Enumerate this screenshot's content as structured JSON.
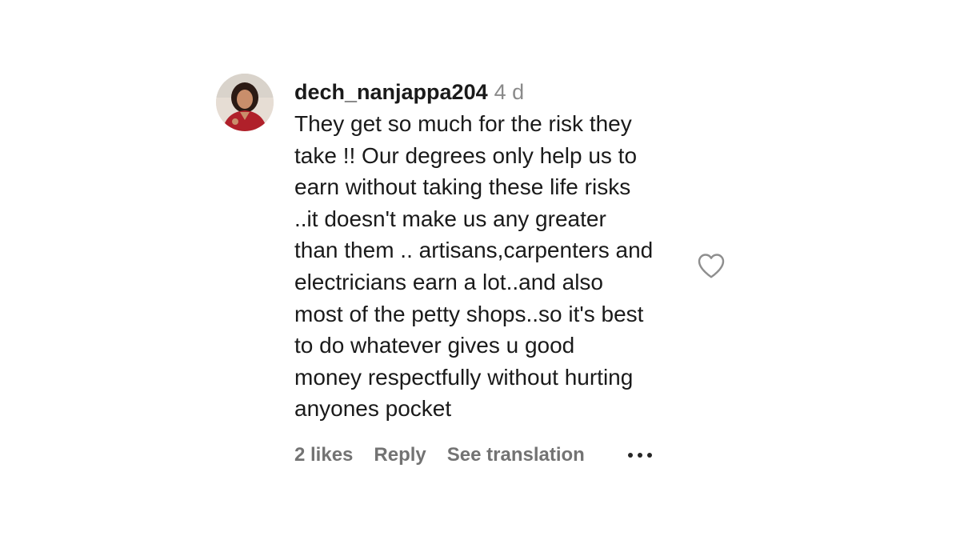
{
  "comment": {
    "username": "dech_nanjappa204",
    "time": "4 d",
    "text": "They get so much for the risk they\ntake !! Our degrees only help us to\nearn without taking these life risks\n..it doesn't make us any greater\nthan them .. artisans,carpenters and\nelectricians earn a lot..and also\nmost of the petty shops..so it's best\nto do whatever gives u good\nmoney respectfully without hurting\nanyones pocket",
    "likes": "2 likes",
    "reply_label": "Reply",
    "translate_label": "See translation",
    "more_icon": "more-horizontal-icon",
    "like_icon": "heart-outline-icon",
    "avatar_icon": "user-avatar"
  },
  "colors": {
    "text": "#1a1a1a",
    "muted": "#737373",
    "time": "#8a8a8a",
    "avatar_dress": "#b0202a"
  }
}
